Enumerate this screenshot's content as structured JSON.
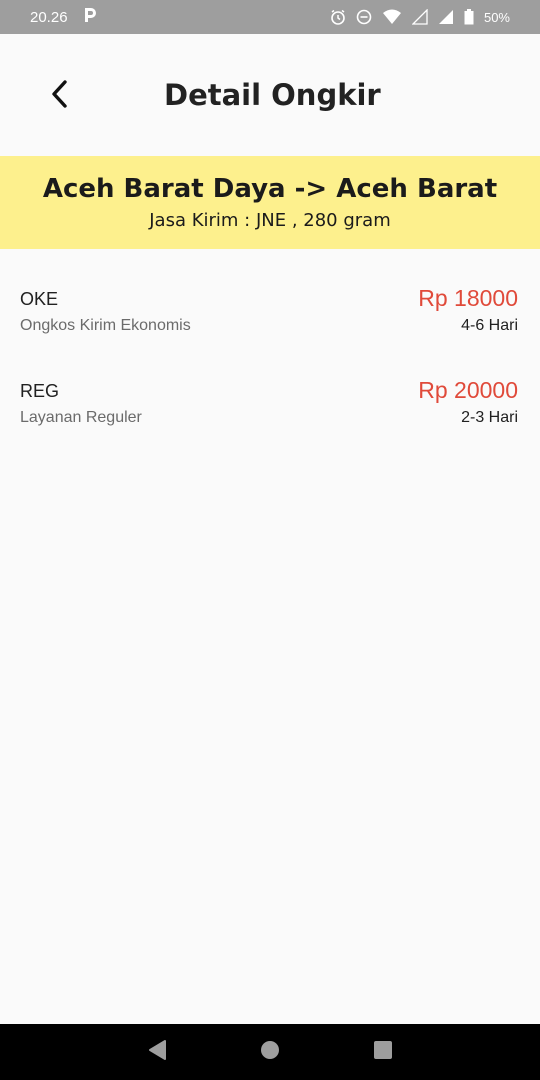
{
  "status_bar": {
    "time": "20.26",
    "battery": "50%",
    "icons": [
      "p-icon",
      "alarm-icon",
      "dnd-icon",
      "wifi-icon",
      "signal-empty-icon",
      "signal-icon",
      "battery-icon"
    ]
  },
  "app_bar": {
    "title": "Detail Ongkir",
    "back_icon": "chevron-left-icon"
  },
  "route": {
    "title": "Aceh Barat Daya -> Aceh Barat",
    "subtitle": "Jasa Kirim : JNE , 280 gram"
  },
  "services": [
    {
      "code": "OKE",
      "description": "Ongkos Kirim Ekonomis",
      "price": "Rp 18000",
      "eta": "4-6 Hari"
    },
    {
      "code": "REG",
      "description": "Layanan Reguler",
      "price": "Rp 20000",
      "eta": "2-3 Hari"
    }
  ],
  "colors": {
    "banner": "#fdf08d",
    "price": "#e04a3a",
    "status_bar": "#9e9e9e",
    "nav_bar": "#000000"
  },
  "nav_bar": {
    "icons": [
      "back-triangle-icon",
      "home-circle-icon",
      "recents-square-icon"
    ]
  }
}
